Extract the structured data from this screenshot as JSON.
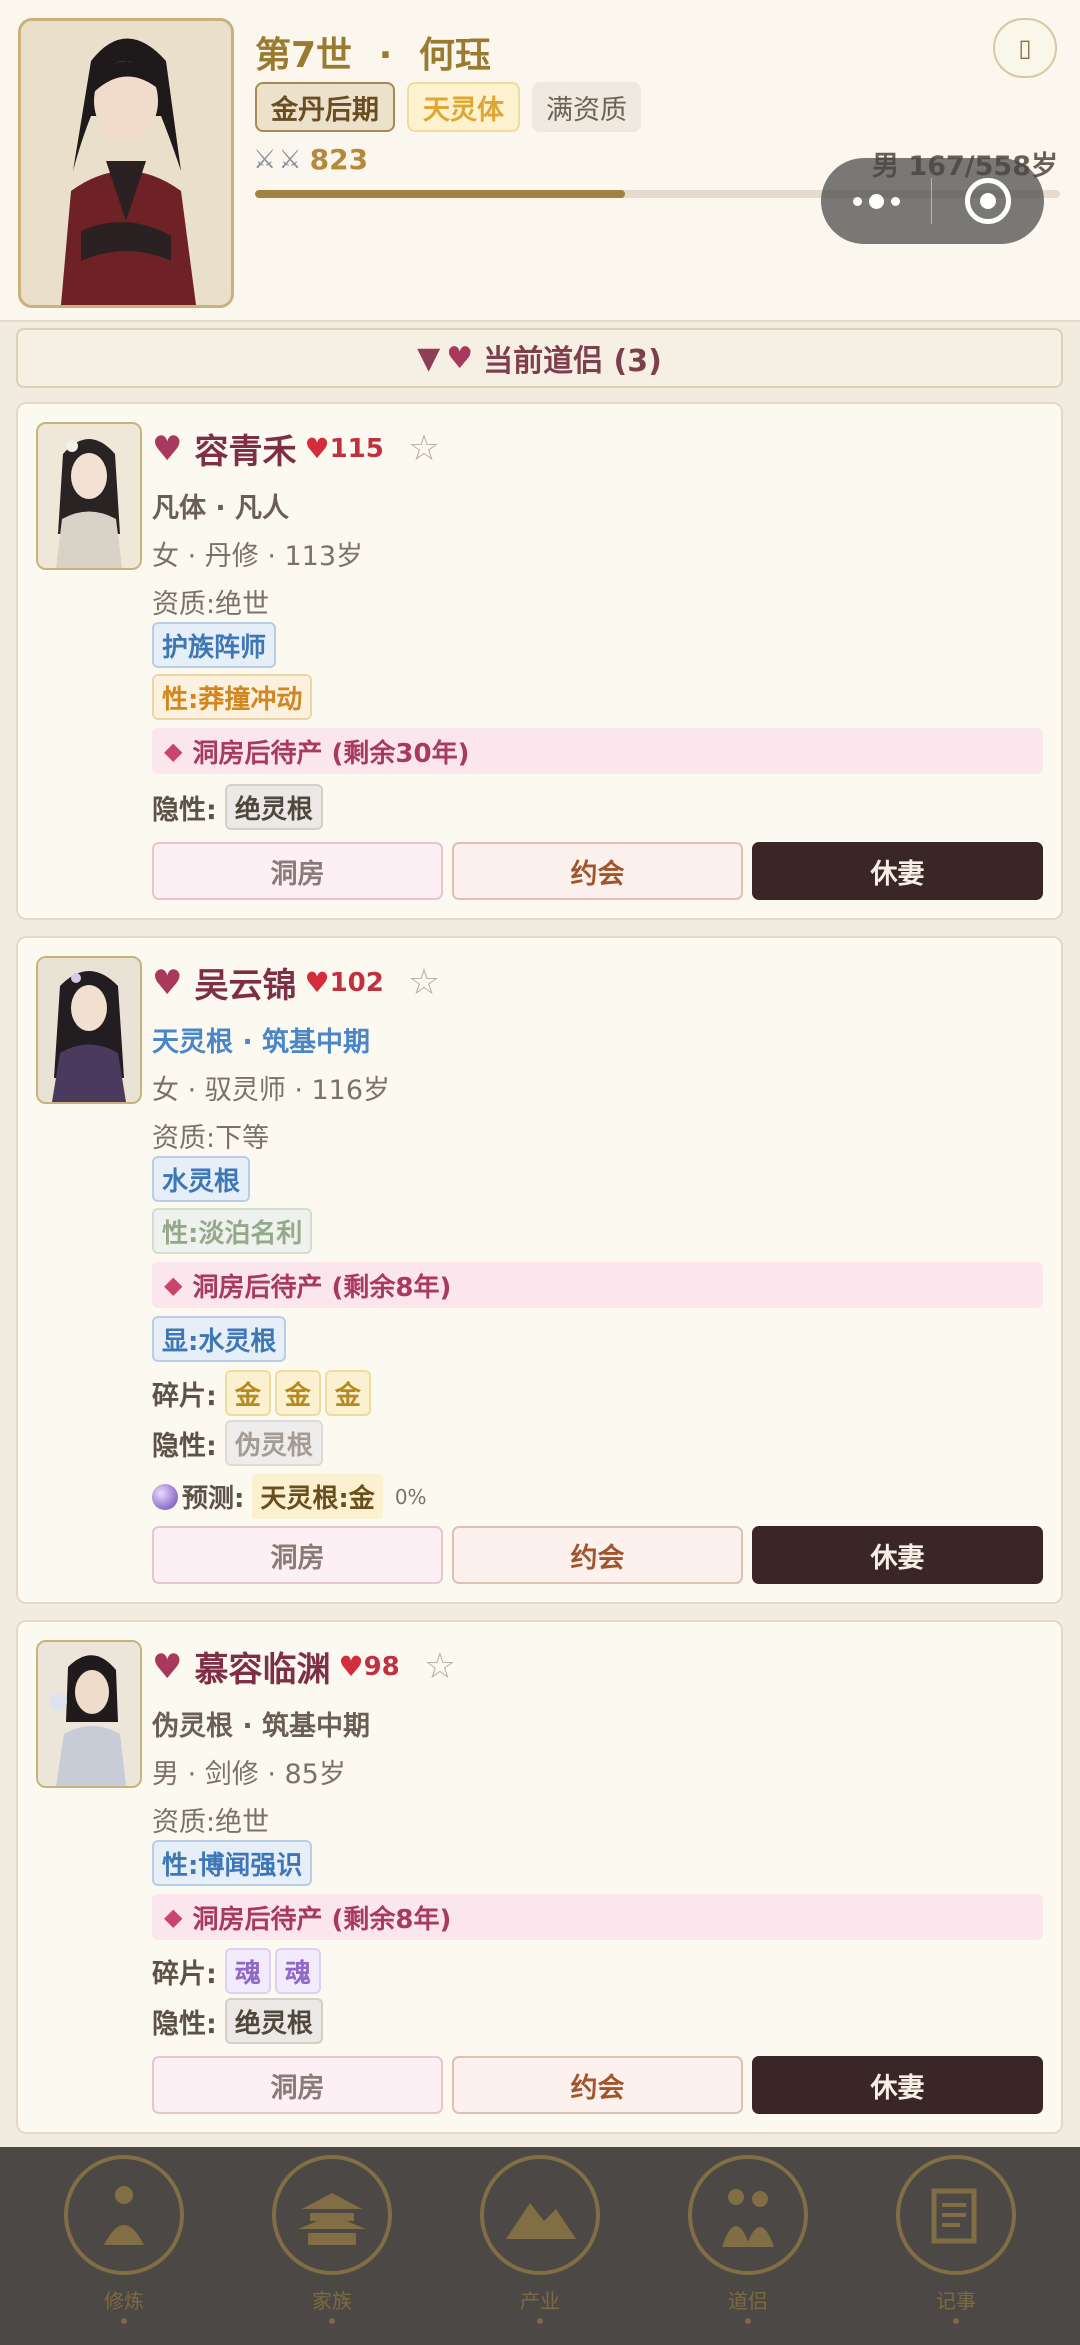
{
  "player": {
    "generation": "第7世",
    "separator": "·",
    "name": "何珏",
    "realm": "金丹后期",
    "body": "天灵体",
    "aptitude": "满资质",
    "power": "823",
    "age": "男 167/558岁",
    "exp_progress": 0.46
  },
  "section": {
    "title": "当前道侣 (3)"
  },
  "partners": [
    {
      "name": "容青禾",
      "affection": "115",
      "line1": "凡体 · 凡人",
      "line2": "女 · 丹修 · 113岁",
      "aptitude": "资质:绝世",
      "role_chip": "护族阵师",
      "trait_chip": "性:莽撞冲动",
      "pregnancy": "洞房后待产 (剩余30年)",
      "hidden_label": "隐性:",
      "hidden_chip": "绝灵根",
      "buttons": {
        "wed": "洞房",
        "date": "约会",
        "divorce": "休妻"
      }
    },
    {
      "name": "吴云锦",
      "affection": "102",
      "line1": "天灵根 · 筑基中期",
      "line2": "女 · 驭灵师 · 116岁",
      "aptitude": "资质:下等",
      "root_chip": "水灵根",
      "trait_chip": "性:淡泊名利",
      "pregnancy": "洞房后待产 (剩余8年)",
      "dominant_chip": "显:水灵根",
      "fragments_label": "碎片:",
      "fragments": [
        "金",
        "金",
        "金"
      ],
      "hidden_label": "隐性:",
      "hidden_chip": "伪灵根",
      "predict_label": "预测:",
      "predict_value": "天灵根:金",
      "predict_pct": "0%",
      "buttons": {
        "wed": "洞房",
        "date": "约会",
        "divorce": "休妻"
      }
    },
    {
      "name": "慕容临渊",
      "affection": "98",
      "line1": "伪灵根 · 筑基中期",
      "line2": "男 · 剑修 · 85岁",
      "aptitude": "资质:绝世",
      "trait_chip": "性:博闻强识",
      "pregnancy": "洞房后待产 (剩余8年)",
      "fragments_label": "碎片:",
      "fragments": [
        "魂",
        "魂"
      ],
      "hidden_label": "隐性:",
      "hidden_chip": "绝灵根",
      "buttons": {
        "wed": "洞房",
        "date": "约会",
        "divorce": "休妻"
      }
    }
  ],
  "nav": [
    "修炼",
    "家族",
    "产业",
    "道侣",
    "记事"
  ],
  "colors": {
    "accent_gold": "#9a7a2e",
    "name_red": "#7e2f45",
    "nav_bg": "#4b4845"
  }
}
